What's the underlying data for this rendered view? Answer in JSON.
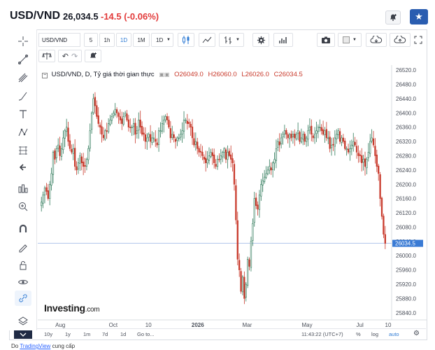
{
  "header": {
    "pair": "USD/VND",
    "price": "26,034.5",
    "change": "-14.5 (-0.06%)"
  },
  "toolbar": {
    "symbol": "USD/VND",
    "intervals": [
      "5",
      "1h",
      "1D",
      "1M"
    ],
    "interval_selected": "1D",
    "interval_dropdown": "1D"
  },
  "legend": {
    "title": "USD/VND, D, Tỷ giá thời gian thực",
    "open": "O26049.0",
    "high": "H26060.0",
    "low": "L26026.0",
    "close": "C26034.5"
  },
  "logo": {
    "name": "Investing",
    "domain": ".com"
  },
  "bottom_bar": {
    "ranges": [
      "10y",
      "1y",
      "1m",
      "7d",
      "1d"
    ],
    "goto": "Go to...",
    "time": "11:43:22 (UTC+7)",
    "percent": "%",
    "log": "log",
    "auto": "auto"
  },
  "footer": {
    "prefix": "Do ",
    "link": "TradingView",
    "suffix": " cung cấp"
  },
  "chart_data": {
    "type": "candlestick",
    "y_ticks": [
      25840,
      25880,
      25920,
      25960,
      26000,
      26040,
      26080,
      26120,
      26160,
      26200,
      26240,
      26280,
      26320,
      26360,
      26400,
      26440,
      26480,
      26520
    ],
    "ylim": [
      25820,
      26530
    ],
    "x_ticks": [
      "Aug",
      "Oct",
      "10",
      "2026",
      "Mar",
      "May",
      "Jul",
      "10"
    ],
    "last_price": 26034.5,
    "last_price_label": "26034.5",
    "up_color": "#2f7a5a",
    "down_color": "#c8392b",
    "close_series": [
      26150,
      26170,
      26190,
      26180,
      26160,
      26200,
      26230,
      26290,
      26270,
      26300,
      26310,
      26280,
      26300,
      26330,
      26350,
      26360,
      26320,
      26300,
      26290,
      26300,
      26250,
      26240,
      26260,
      26280,
      26260,
      26250,
      26250,
      26270,
      26300,
      26350,
      26400,
      26440,
      26420,
      26390,
      26370,
      26360,
      26340,
      26330,
      26350,
      26350,
      26370,
      26380,
      26390,
      26400,
      26410,
      26400,
      26390,
      26380,
      26370,
      26390,
      26400,
      26380,
      26360,
      26360,
      26360,
      26370,
      26340,
      26350,
      26380,
      26360,
      26340,
      26340,
      26320,
      26330,
      26340,
      26320,
      26330,
      26330,
      26320,
      26310,
      26350,
      26350,
      26370,
      26380,
      26390,
      26380,
      26360,
      26330,
      26340,
      26330,
      26320,
      26330,
      26330,
      26340,
      26350,
      26380,
      26380,
      26370,
      26370,
      26360,
      26330,
      26310,
      26320,
      26300,
      26290,
      26290,
      26280,
      26270,
      26260,
      26270,
      26280,
      26290,
      26280,
      26260,
      26250,
      26270,
      26270,
      26280,
      26290,
      26300,
      26270,
      26290,
      26280,
      26270,
      26260,
      26200,
      26100,
      25990,
      25960,
      25900,
      25940,
      25880,
      25920,
      25990,
      25970,
      26040,
      26090,
      26160,
      26140,
      26130,
      26170,
      26200,
      26210,
      26220,
      26230,
      26240,
      26250,
      26240,
      26260,
      26270,
      26300,
      26320,
      26310,
      26330,
      26340,
      26350,
      26340,
      26330,
      26340,
      26330,
      26340,
      26330,
      26340,
      26350,
      26320,
      26330,
      26340,
      26320,
      26330,
      26350,
      26360,
      26340,
      26330,
      26340,
      26350,
      26360,
      26360,
      26350,
      26340,
      26350,
      26330,
      26330,
      26300,
      26310,
      26310,
      26330,
      26340,
      26350,
      26320,
      26330,
      26320,
      26300,
      26300,
      26290,
      26300,
      26310,
      26320,
      26310,
      26290,
      26280,
      26280,
      26260,
      26270,
      26250,
      26270,
      26290,
      26320,
      26330,
      26310,
      26280,
      26250,
      26230,
      26160,
      26110,
      26060,
      26034.5
    ]
  },
  "icons": {
    "left_tools": [
      "crosshair-icon",
      "trend-line-icon",
      "pitchfork-icon",
      "brush-icon",
      "text-icon",
      "pattern-icon",
      "measure-icon",
      "back-arrow-icon",
      "indicators-icon",
      "zoom-icon",
      "magnet-icon",
      "stay-in-drawing-icon",
      "lock-icon",
      "eye-icon",
      "link-icon",
      "layers-icon",
      "collapse-icon"
    ]
  }
}
